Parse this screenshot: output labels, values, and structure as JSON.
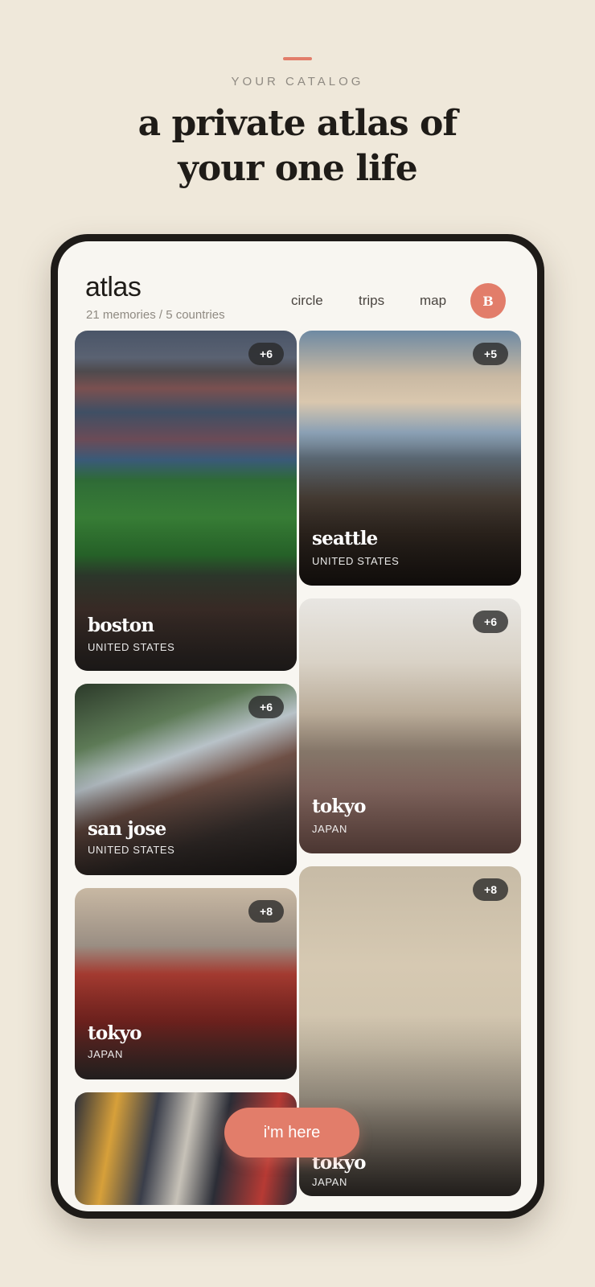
{
  "hero": {
    "kicker": "YOUR CATALOG",
    "headline_line1": "a private atlas of",
    "headline_line2": "your one life"
  },
  "app": {
    "title": "atlas",
    "subtitle": "21 memories / 5 countries",
    "nav": [
      "circle",
      "trips",
      "map"
    ],
    "avatar_initial": "B"
  },
  "cards": [
    {
      "city": "boston",
      "country": "UNITED STATES",
      "count": "+6"
    },
    {
      "city": "seattle",
      "country": "UNITED STATES",
      "count": "+5"
    },
    {
      "city": "san jose",
      "country": "UNITED STATES",
      "count": "+6"
    },
    {
      "city": "tokyo",
      "country": "JAPAN",
      "count": "+6"
    },
    {
      "city": "tokyo",
      "country": "JAPAN",
      "count": "+8"
    },
    {
      "city": "tokyo",
      "country": "JAPAN",
      "count": "+8"
    }
  ],
  "cta_label": "i'm here",
  "colors": {
    "background": "#efe8da",
    "accent": "#e27d6a",
    "screen": "#f8f6f1",
    "device": "#1e1b18"
  }
}
